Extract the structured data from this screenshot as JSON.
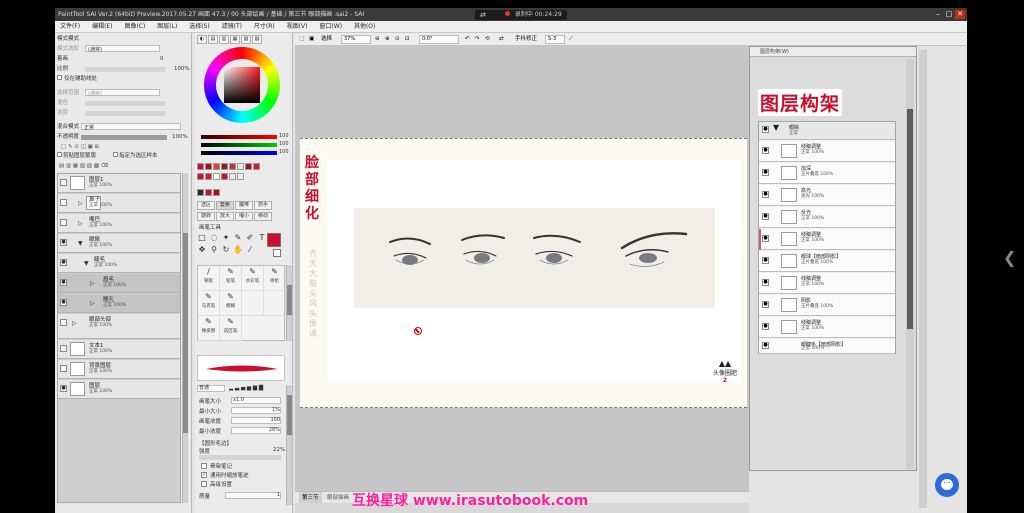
{
  "window": {
    "title": "PaintTool SAI Ver.2 (64bit) Preview.2017.05.27   画面 47.3 / 00 头部绘画 / 基础 / 第三节 眼部描画 .sai2 - SAI",
    "recording_time": "录制中 00:24:29"
  },
  "menu": [
    "文件(F)",
    "编辑(E)",
    "图像(C)",
    "图层(L)",
    "选择(S)",
    "滤镜(T)",
    "尺寸(R)",
    "视图(V)",
    "窗口(W)",
    "其他(O)"
  ],
  "left_panel": {
    "mode_label": "模式模式",
    "rows": [
      "模式选取",
      "着画",
      "比例",
      "仅在辅助线处",
      "选择范围",
      "混色",
      "浓度"
    ],
    "fields": [
      "(通常)",
      "0",
      "100%",
      "(通常)"
    ],
    "blend_label": "混合模式",
    "blend_value": "正常",
    "opacity_label": "不透明度",
    "opacity_value": "100%",
    "protect": [
      "剪贴图层蒙版",
      "指定为选区样本"
    ],
    "layers": [
      {
        "name": "图层1",
        "sub": "正常 100%"
      },
      {
        "name": "鼻子",
        "sub": "正常 100%"
      },
      {
        "name": "嘴巴",
        "sub": "正常 100%"
      },
      {
        "name": "眼睛",
        "sub": "正常 100%"
      },
      {
        "name": "睫毛",
        "sub": "正常 100%"
      },
      {
        "name": "眉毛",
        "sub": "正常 100%"
      },
      {
        "name": "瞳孔",
        "sub": "正常 100%"
      },
      {
        "name": "眼部头部",
        "sub": "正常 100%"
      },
      {
        "name": "文本1",
        "sub": "正常 100%"
      },
      {
        "name": "背景图层",
        "sub": "正常 100%"
      },
      {
        "name": "图层",
        "sub": "正常 100%"
      }
    ]
  },
  "tool_panel": {
    "rgb_values": [
      "100",
      "100",
      "100"
    ],
    "swatch_colors": [
      "#c8102e",
      "#b01010",
      "#e04040",
      "#802020",
      "#c83030",
      "#e8e8e8",
      "#a01818",
      "#d02020"
    ],
    "tool_buttons": [
      "选区",
      "套索",
      "魔棒",
      "抓手",
      "旋转",
      "放大",
      "缩小",
      "移动"
    ],
    "tool_group_label": "画笔工具",
    "brushes": [
      {
        "name": "钢笔"
      },
      {
        "name": "铅笔"
      },
      {
        "name": "水彩笔"
      },
      {
        "name": "喷枪"
      },
      {
        "name": "马克笔"
      },
      {
        "name": "模糊"
      },
      {
        "name": "橡皮擦"
      },
      {
        "name": "选区笔"
      }
    ],
    "brush_mode": "普通",
    "props": [
      {
        "label": "画笔大小",
        "value": "x1.0"
      },
      {
        "label": "最小大小",
        "value": "1%"
      },
      {
        "label": "画笔浓度",
        "value": "100"
      },
      {
        "label": "最小浓度",
        "value": "28%"
      }
    ],
    "texture_label": "【圆形毛边】",
    "texture_value": "强度",
    "texture_pct": "22%",
    "options": [
      "晕染笔记",
      "通用时缩放笔迹",
      "高级设置"
    ],
    "preset_label": "质量",
    "preset_value": "1"
  },
  "toolbar": {
    "select_label": "选择",
    "zoom_value": "37%",
    "angle_value": "0.0°",
    "stabilizer_label": "手抖修正",
    "stabilizer_value": "S-3"
  },
  "canvas": {
    "vertical_title": "脸部细化",
    "vertical_credit": "齐天大猫头风头像课",
    "logo_text": "头像圈肥",
    "logo_number": "2"
  },
  "status": {
    "tab_label": "第三节",
    "tab_file": "眼部描画"
  },
  "right_window": {
    "title": "图层构架(W)",
    "heading": "图层构架",
    "group_name": "眼睛",
    "group_sub": "正常",
    "rows": [
      {
        "name": "线稿调整",
        "sub": "正常 100%"
      },
      {
        "name": "加深",
        "sub": "正片叠底 100%"
      },
      {
        "name": "高光",
        "sub": "发光 100%"
      },
      {
        "name": "反光",
        "sub": "正常 100%"
      },
      {
        "name": "线稿调整",
        "sub": "正常 100%"
      },
      {
        "name": "眼球【暗部阴影】",
        "sub": "正片叠底 100%"
      },
      {
        "name": "线稿调整",
        "sub": "正常 100%"
      },
      {
        "name": "阴影",
        "sub": "正片叠底 100%"
      },
      {
        "name": "线稿调整",
        "sub": "正常 100%"
      },
      {
        "name": "眼睫毛【暗部阴影】",
        "sub": "正常 100%"
      }
    ]
  },
  "watermark": "互换星球 www.irasutobook.com"
}
